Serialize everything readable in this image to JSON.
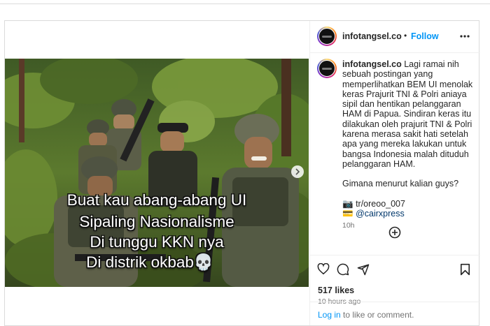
{
  "post": {
    "username": "infotangsel.co",
    "follow_label": "Follow",
    "more_icon": "more-horizontal-icon",
    "media": {
      "overlay_lines": [
        "Buat kau abang-abang UI",
        "Sipaling Nasionalisme",
        "Di tunggu KKN nya",
        "Di distrik okbab"
      ],
      "emoji": "💀",
      "next_icon": "chevron-right-icon"
    },
    "caption": {
      "username": "infotangsel.co",
      "text": "Lagi ramai nih sebuah postingan yang memperlihatkan BEM UI menolak keras Prajurit TNI & Polri aniaya sipil dan hentikan pelanggaran HAM di Papua. Sindiran keras itu dilakukan oleh prajurit TNI & Polri karena merasa sakit hati setelah apa yang mereka lakukan untuk bangsa Indonesia malah dituduh pelanggaran HAM.",
      "question": "Gimana menurut kalian guys?",
      "credit1_emoji": "📷",
      "credit1": "tr/oreoo_007",
      "credit2_emoji": "💳",
      "credit2": "@cairxpress",
      "time": "10h"
    },
    "add_comment_icon": "plus-circle-icon",
    "actions": {
      "like_icon": "heart-icon",
      "comment_icon": "comment-icon",
      "share_icon": "send-icon",
      "save_icon": "bookmark-icon"
    },
    "likes": "517 likes",
    "posted_ago": "10 hours ago",
    "footer": {
      "login_label": "Log in",
      "rest": " to like or comment."
    }
  },
  "colors": {
    "accent": "#0095f6",
    "text": "#262626",
    "muted": "#737373",
    "border": "#dbdbdb"
  }
}
